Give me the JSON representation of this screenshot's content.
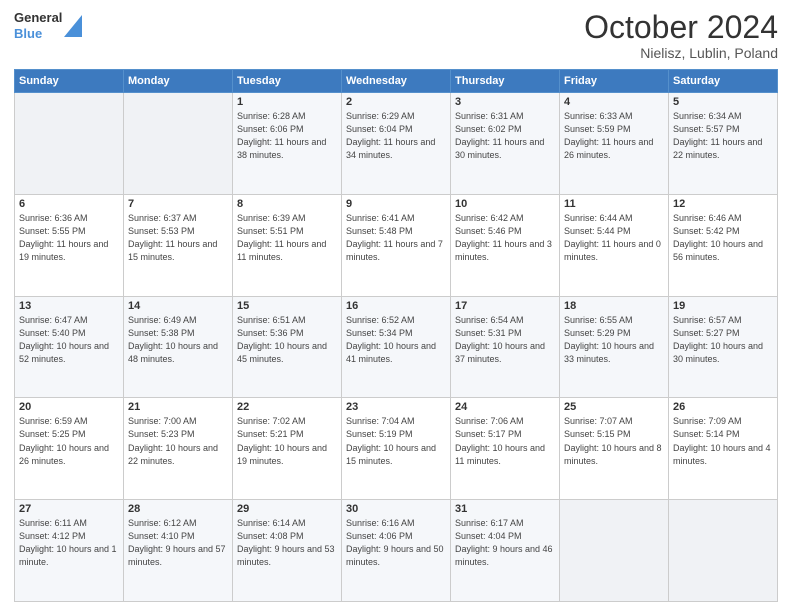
{
  "header": {
    "logo_general": "General",
    "logo_blue": "Blue",
    "month_title": "October 2024",
    "location": "Nielisz, Lublin, Poland"
  },
  "days_of_week": [
    "Sunday",
    "Monday",
    "Tuesday",
    "Wednesday",
    "Thursday",
    "Friday",
    "Saturday"
  ],
  "weeks": [
    [
      {
        "num": "",
        "info": ""
      },
      {
        "num": "",
        "info": ""
      },
      {
        "num": "1",
        "info": "Sunrise: 6:28 AM\nSunset: 6:06 PM\nDaylight: 11 hours and 38 minutes."
      },
      {
        "num": "2",
        "info": "Sunrise: 6:29 AM\nSunset: 6:04 PM\nDaylight: 11 hours and 34 minutes."
      },
      {
        "num": "3",
        "info": "Sunrise: 6:31 AM\nSunset: 6:02 PM\nDaylight: 11 hours and 30 minutes."
      },
      {
        "num": "4",
        "info": "Sunrise: 6:33 AM\nSunset: 5:59 PM\nDaylight: 11 hours and 26 minutes."
      },
      {
        "num": "5",
        "info": "Sunrise: 6:34 AM\nSunset: 5:57 PM\nDaylight: 11 hours and 22 minutes."
      }
    ],
    [
      {
        "num": "6",
        "info": "Sunrise: 6:36 AM\nSunset: 5:55 PM\nDaylight: 11 hours and 19 minutes."
      },
      {
        "num": "7",
        "info": "Sunrise: 6:37 AM\nSunset: 5:53 PM\nDaylight: 11 hours and 15 minutes."
      },
      {
        "num": "8",
        "info": "Sunrise: 6:39 AM\nSunset: 5:51 PM\nDaylight: 11 hours and 11 minutes."
      },
      {
        "num": "9",
        "info": "Sunrise: 6:41 AM\nSunset: 5:48 PM\nDaylight: 11 hours and 7 minutes."
      },
      {
        "num": "10",
        "info": "Sunrise: 6:42 AM\nSunset: 5:46 PM\nDaylight: 11 hours and 3 minutes."
      },
      {
        "num": "11",
        "info": "Sunrise: 6:44 AM\nSunset: 5:44 PM\nDaylight: 11 hours and 0 minutes."
      },
      {
        "num": "12",
        "info": "Sunrise: 6:46 AM\nSunset: 5:42 PM\nDaylight: 10 hours and 56 minutes."
      }
    ],
    [
      {
        "num": "13",
        "info": "Sunrise: 6:47 AM\nSunset: 5:40 PM\nDaylight: 10 hours and 52 minutes."
      },
      {
        "num": "14",
        "info": "Sunrise: 6:49 AM\nSunset: 5:38 PM\nDaylight: 10 hours and 48 minutes."
      },
      {
        "num": "15",
        "info": "Sunrise: 6:51 AM\nSunset: 5:36 PM\nDaylight: 10 hours and 45 minutes."
      },
      {
        "num": "16",
        "info": "Sunrise: 6:52 AM\nSunset: 5:34 PM\nDaylight: 10 hours and 41 minutes."
      },
      {
        "num": "17",
        "info": "Sunrise: 6:54 AM\nSunset: 5:31 PM\nDaylight: 10 hours and 37 minutes."
      },
      {
        "num": "18",
        "info": "Sunrise: 6:55 AM\nSunset: 5:29 PM\nDaylight: 10 hours and 33 minutes."
      },
      {
        "num": "19",
        "info": "Sunrise: 6:57 AM\nSunset: 5:27 PM\nDaylight: 10 hours and 30 minutes."
      }
    ],
    [
      {
        "num": "20",
        "info": "Sunrise: 6:59 AM\nSunset: 5:25 PM\nDaylight: 10 hours and 26 minutes."
      },
      {
        "num": "21",
        "info": "Sunrise: 7:00 AM\nSunset: 5:23 PM\nDaylight: 10 hours and 22 minutes."
      },
      {
        "num": "22",
        "info": "Sunrise: 7:02 AM\nSunset: 5:21 PM\nDaylight: 10 hours and 19 minutes."
      },
      {
        "num": "23",
        "info": "Sunrise: 7:04 AM\nSunset: 5:19 PM\nDaylight: 10 hours and 15 minutes."
      },
      {
        "num": "24",
        "info": "Sunrise: 7:06 AM\nSunset: 5:17 PM\nDaylight: 10 hours and 11 minutes."
      },
      {
        "num": "25",
        "info": "Sunrise: 7:07 AM\nSunset: 5:15 PM\nDaylight: 10 hours and 8 minutes."
      },
      {
        "num": "26",
        "info": "Sunrise: 7:09 AM\nSunset: 5:14 PM\nDaylight: 10 hours and 4 minutes."
      }
    ],
    [
      {
        "num": "27",
        "info": "Sunrise: 6:11 AM\nSunset: 4:12 PM\nDaylight: 10 hours and 1 minute."
      },
      {
        "num": "28",
        "info": "Sunrise: 6:12 AM\nSunset: 4:10 PM\nDaylight: 9 hours and 57 minutes."
      },
      {
        "num": "29",
        "info": "Sunrise: 6:14 AM\nSunset: 4:08 PM\nDaylight: 9 hours and 53 minutes."
      },
      {
        "num": "30",
        "info": "Sunrise: 6:16 AM\nSunset: 4:06 PM\nDaylight: 9 hours and 50 minutes."
      },
      {
        "num": "31",
        "info": "Sunrise: 6:17 AM\nSunset: 4:04 PM\nDaylight: 9 hours and 46 minutes."
      },
      {
        "num": "",
        "info": ""
      },
      {
        "num": "",
        "info": ""
      }
    ]
  ]
}
